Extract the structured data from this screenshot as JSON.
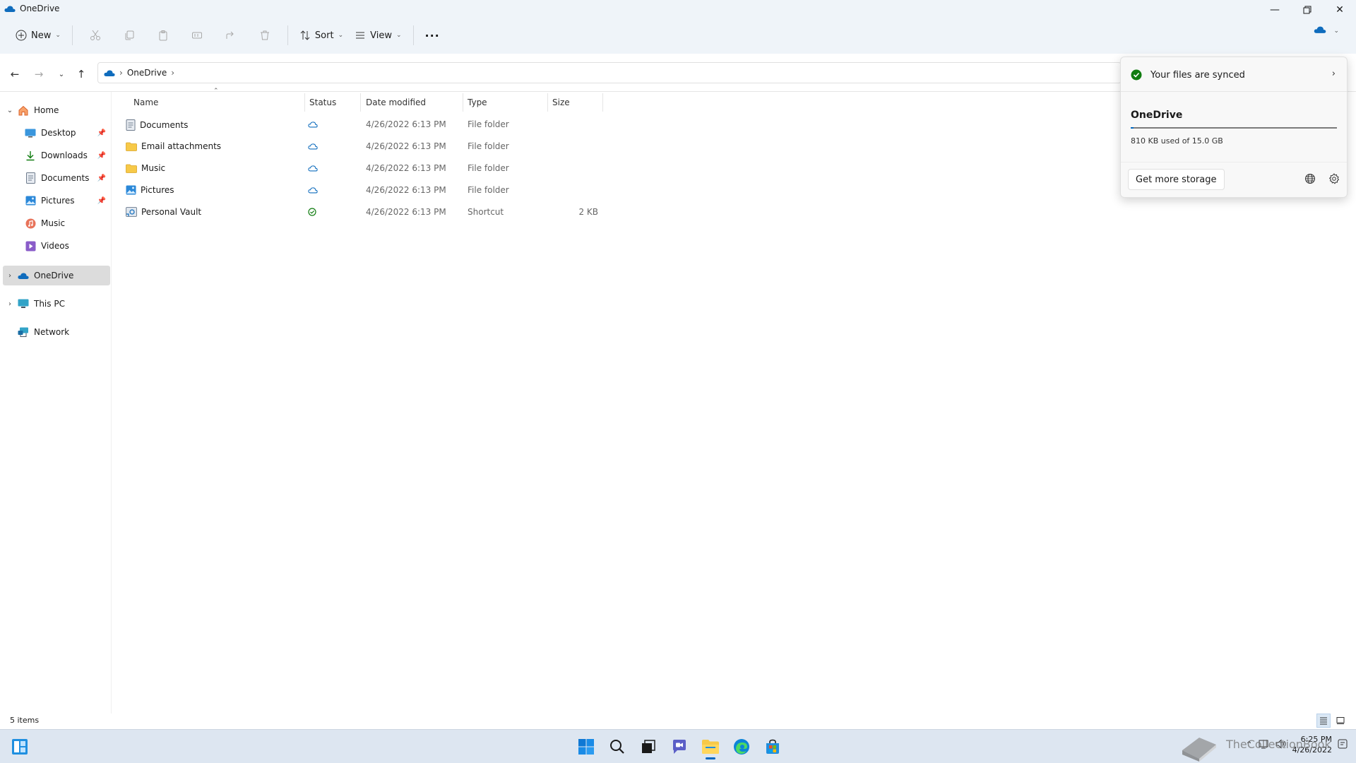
{
  "window": {
    "title": "OneDrive",
    "controls": [
      "minimize",
      "restore",
      "close"
    ]
  },
  "toolbar": {
    "new_label": "New",
    "sort_label": "Sort",
    "view_label": "View",
    "more_label": "···",
    "icons": [
      "cut-icon",
      "copy-icon",
      "paste-icon",
      "rename-icon",
      "share-icon",
      "delete-icon"
    ]
  },
  "address": {
    "crumbs": [
      "OneDrive"
    ]
  },
  "sidebar": {
    "items": [
      {
        "label": "Home",
        "icon": "home-icon",
        "expanded": true
      },
      {
        "label": "Desktop",
        "icon": "desktop-icon",
        "pinned": true
      },
      {
        "label": "Downloads",
        "icon": "downloads-icon",
        "pinned": true
      },
      {
        "label": "Documents",
        "icon": "documents-icon",
        "pinned": true
      },
      {
        "label": "Pictures",
        "icon": "pictures-icon",
        "pinned": true
      },
      {
        "label": "Music",
        "icon": "music-icon"
      },
      {
        "label": "Videos",
        "icon": "videos-icon"
      },
      {
        "label": "OneDrive",
        "icon": "cloud-icon",
        "selected": true
      },
      {
        "label": "This PC",
        "icon": "pc-icon"
      },
      {
        "label": "Network",
        "icon": "network-icon"
      }
    ]
  },
  "filelist": {
    "columns": [
      "Name",
      "Status",
      "Date modified",
      "Type",
      "Size"
    ],
    "rows": [
      {
        "name": "Documents",
        "status": "cloud",
        "date": "4/26/2022 6:13 PM",
        "type": "File folder",
        "size": ""
      },
      {
        "name": "Email attachments",
        "status": "cloud",
        "date": "4/26/2022 6:13 PM",
        "type": "File folder",
        "size": ""
      },
      {
        "name": "Music",
        "status": "cloud",
        "date": "4/26/2022 6:13 PM",
        "type": "File folder",
        "size": ""
      },
      {
        "name": "Pictures",
        "status": "cloud",
        "date": "4/26/2022 6:13 PM",
        "type": "File folder",
        "size": ""
      },
      {
        "name": "Personal Vault",
        "status": "synced",
        "date": "4/26/2022 6:13 PM",
        "type": "Shortcut",
        "size": "2 KB"
      }
    ]
  },
  "flyout": {
    "sync_status": "Your files are synced",
    "title": "OneDrive",
    "usage": "810 KB used of 15.0 GB",
    "usage_fraction": 5e-05,
    "button_label": "Get more storage"
  },
  "statusbar": {
    "item_count": "5 items"
  },
  "taskbar": {
    "time": "6:25 PM",
    "date": "4/26/2022",
    "watermark": "TheCollectionBook"
  },
  "colors": {
    "accent": "#0067c0",
    "folder": "#f7c948",
    "sync_green": "#107c10",
    "cloud_blue": "#0f6cbd"
  }
}
